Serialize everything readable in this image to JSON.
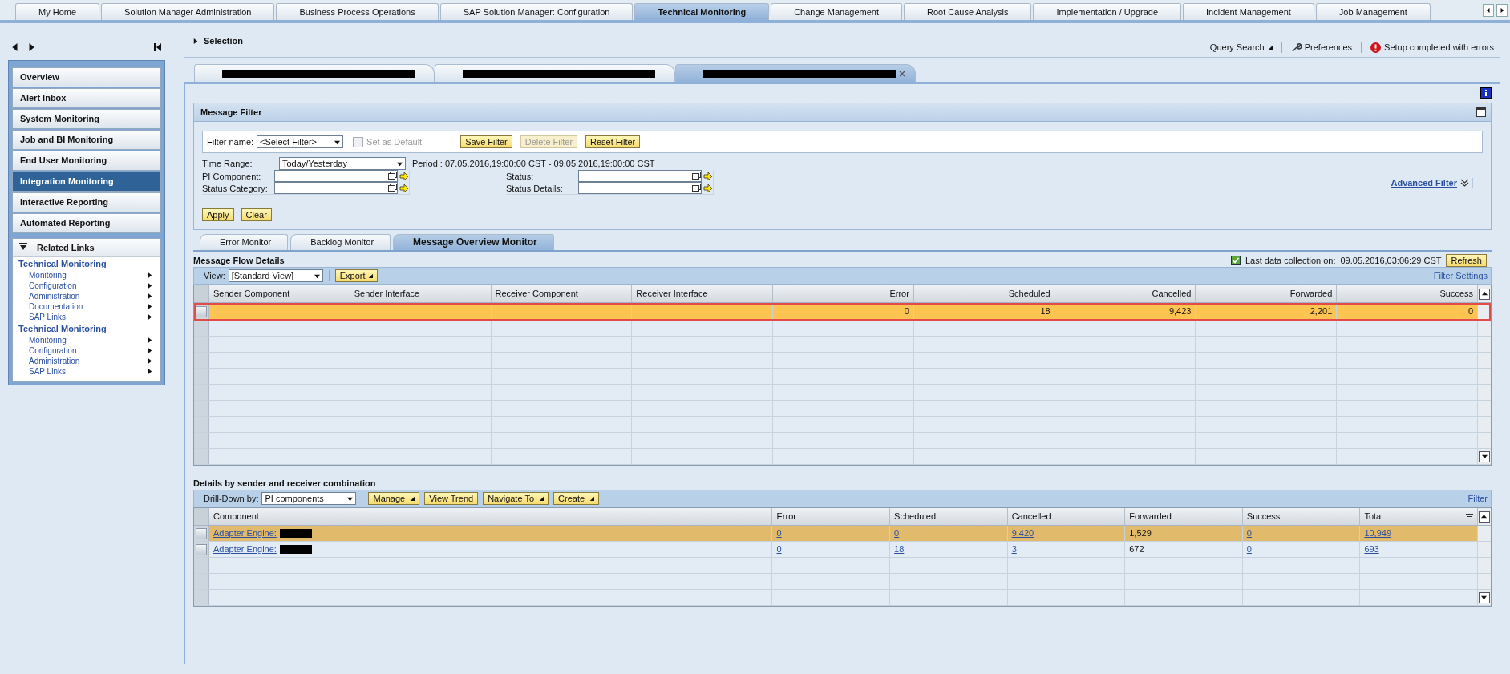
{
  "top_tabs": [
    {
      "label": "My Home",
      "selected": false
    },
    {
      "label": "Solution Manager Administration",
      "selected": false
    },
    {
      "label": "Business Process Operations",
      "selected": false
    },
    {
      "label": "SAP Solution Manager: Configuration",
      "selected": false
    },
    {
      "label": "Technical Monitoring",
      "selected": true
    },
    {
      "label": "Change Management",
      "selected": false
    },
    {
      "label": "Root Cause Analysis",
      "selected": false
    },
    {
      "label": "Implementation / Upgrade",
      "selected": false
    },
    {
      "label": "Incident Management",
      "selected": false
    },
    {
      "label": "Job Management",
      "selected": false
    }
  ],
  "sidebar": {
    "nav_items": [
      {
        "label": "Overview",
        "selected": false
      },
      {
        "label": "Alert Inbox",
        "selected": false
      },
      {
        "label": "System Monitoring",
        "selected": false
      },
      {
        "label": "Job and BI Monitoring",
        "selected": false
      },
      {
        "label": "End User Monitoring",
        "selected": false
      },
      {
        "label": "Integration Monitoring",
        "selected": true
      },
      {
        "label": "Interactive Reporting",
        "selected": false
      },
      {
        "label": "Automated Reporting",
        "selected": false
      }
    ],
    "related_links": {
      "title": "Related Links",
      "groups": [
        {
          "title": "Technical Monitoring",
          "links": [
            "Monitoring",
            "Configuration",
            "Administration",
            "Documentation",
            "SAP Links"
          ]
        },
        {
          "title": "Technical Monitoring",
          "links": [
            "Monitoring",
            "Configuration",
            "Administration",
            "SAP Links"
          ]
        }
      ]
    }
  },
  "selection": {
    "label": "Selection",
    "expanded": false
  },
  "toolbar": {
    "query_search": "Query Search",
    "preferences": "Preferences",
    "status": "Setup completed with errors"
  },
  "content_tabs": [
    {
      "selected": false,
      "closable": false
    },
    {
      "selected": false,
      "closable": false
    },
    {
      "selected": true,
      "closable": true
    }
  ],
  "message_filter": {
    "title": "Message Filter",
    "filter_name_label": "Filter name:",
    "filter_name_value": "<Select Filter>",
    "set_as_default": {
      "label": "Set as Default",
      "checked": false,
      "disabled": true
    },
    "buttons": [
      {
        "label": "Save Filter",
        "disabled": false
      },
      {
        "label": "Delete Filter",
        "disabled": true
      },
      {
        "label": "Reset Filter",
        "disabled": false
      }
    ],
    "time_range_label": "Time Range:",
    "time_range_value": "Today/Yesterday",
    "period": "Period : 07.05.2016,19:00:00 CST - 09.05.2016,19:00:00 CST",
    "left_fields": [
      {
        "label": "PI Component:"
      },
      {
        "label": "Status Category:"
      }
    ],
    "right_fields": [
      {
        "label": "Status:"
      },
      {
        "label": "Status Details:"
      }
    ],
    "advanced_filter": "Advanced Filter",
    "apply": "Apply",
    "clear": "Clear"
  },
  "monitor_tabs": [
    {
      "label": "Error Monitor",
      "selected": false
    },
    {
      "label": "Backlog Monitor",
      "selected": false
    },
    {
      "label": "Message Overview Monitor",
      "selected": true
    }
  ],
  "message_flow": {
    "title": "Message Flow Details",
    "last_collection_label": "Last data collection on:",
    "last_collection_value": "09.05.2016,03:06:29 CST",
    "collection_ok": true,
    "refresh": "Refresh",
    "view_label": "View:",
    "view_value": "[Standard View]",
    "export": "Export",
    "filter_settings": "Filter Settings",
    "columns": [
      {
        "label": "Sender Component",
        "kind": "text"
      },
      {
        "label": "Sender Interface",
        "kind": "text"
      },
      {
        "label": "Receiver Component",
        "kind": "text"
      },
      {
        "label": "Receiver Interface",
        "kind": "text"
      },
      {
        "label": "Error",
        "kind": "number"
      },
      {
        "label": "Scheduled",
        "kind": "number"
      },
      {
        "label": "Cancelled",
        "kind": "number"
      },
      {
        "label": "Forwarded",
        "kind": "number"
      },
      {
        "label": "Success",
        "kind": "number"
      }
    ],
    "rows": [
      {
        "selected": true,
        "values": [
          "0",
          "18",
          "9,423",
          "2,201",
          "0"
        ]
      }
    ]
  },
  "details": {
    "title": "Details by sender and receiver combination",
    "drill_down_label": "Drill-Down by:",
    "drill_down_value": "PI components",
    "buttons": [
      {
        "label": "Manage",
        "menu": true
      },
      {
        "label": "View Trend",
        "menu": false
      },
      {
        "label": "Navigate To",
        "menu": true
      },
      {
        "label": "Create",
        "menu": true
      }
    ],
    "filter": "Filter",
    "columns": [
      "Component",
      "Error",
      "Scheduled",
      "Cancelled",
      "Forwarded",
      "Success",
      "Total"
    ],
    "rows": [
      {
        "selected": true,
        "cells": [
          {
            "text": "Adapter Engine:",
            "kind": "link",
            "redacted_suffix": true
          },
          {
            "text": "0",
            "kind": "link"
          },
          {
            "text": "0",
            "kind": "link"
          },
          {
            "text": "9,420",
            "kind": "link"
          },
          {
            "text": "1,529",
            "kind": "text"
          },
          {
            "text": "0",
            "kind": "link"
          },
          {
            "text": "10,949",
            "kind": "link"
          }
        ]
      },
      {
        "selected": false,
        "cells": [
          {
            "text": "Adapter Engine:",
            "kind": "link",
            "redacted_suffix": true
          },
          {
            "text": "0",
            "kind": "link"
          },
          {
            "text": "18",
            "kind": "link"
          },
          {
            "text": "3",
            "kind": "link"
          },
          {
            "text": "672",
            "kind": "text"
          },
          {
            "text": "0",
            "kind": "link"
          },
          {
            "text": "693",
            "kind": "link"
          }
        ]
      }
    ]
  }
}
